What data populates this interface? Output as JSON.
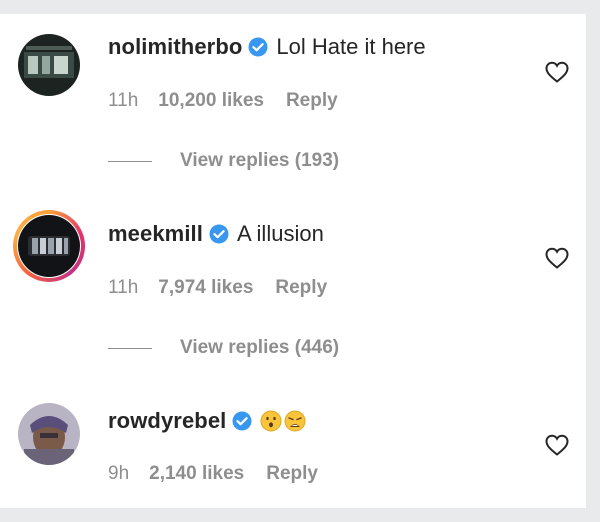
{
  "comments": [
    {
      "username": "nolimitherbo",
      "text": "Lol Hate it here",
      "time": "11h",
      "likes": "10,200 likes",
      "reply_label": "Reply",
      "view_replies": "View replies (193)"
    },
    {
      "username": "meekmill",
      "text": "A illusion",
      "time": "11h",
      "likes": "7,974 likes",
      "reply_label": "Reply",
      "view_replies": "View replies (446)"
    },
    {
      "username": "rowdyrebel",
      "text": "",
      "emojis": [
        "hushed-face-emoji",
        "weary-face-emoji"
      ],
      "time": "9h",
      "likes": "2,140 likes",
      "reply_label": "Reply"
    }
  ],
  "colors": {
    "verified_blue": "#3897f0",
    "meta_gray": "#8e8e8e",
    "text_dark": "#262626"
  }
}
